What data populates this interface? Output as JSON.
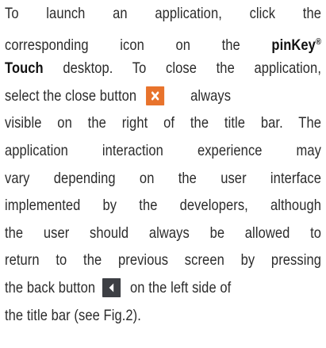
{
  "paragraph": {
    "line1": "To launch an application, click the",
    "line2": "corresponding icon on the",
    "brand_pinkey": "pinKey",
    "brand_reg": "®",
    "brand_touch": "Touch",
    "line3_rest": "desktop. To close the application,",
    "line4_a": "select the close button",
    "line4_b": "always",
    "line5": "visible on the right of the title bar. The",
    "line6": "application interaction experience may",
    "line7": "vary depending on the user interface",
    "line8": "implemented by the developers, although",
    "line9": "the user should always be allowed to",
    "line10": "return to the previous screen by pressing",
    "line11_a": "the back button",
    "line11_b": "on the left side of",
    "line12": "the title bar (see Fig.2)."
  },
  "icons": {
    "close_icon": {
      "name": "close-icon",
      "bg_color": "#e8732c",
      "glyph_color": "#ffffff"
    },
    "back_icon": {
      "name": "chevron-left-icon",
      "bg_color": "#3d3f44",
      "glyph_color": "#ffffff"
    }
  }
}
